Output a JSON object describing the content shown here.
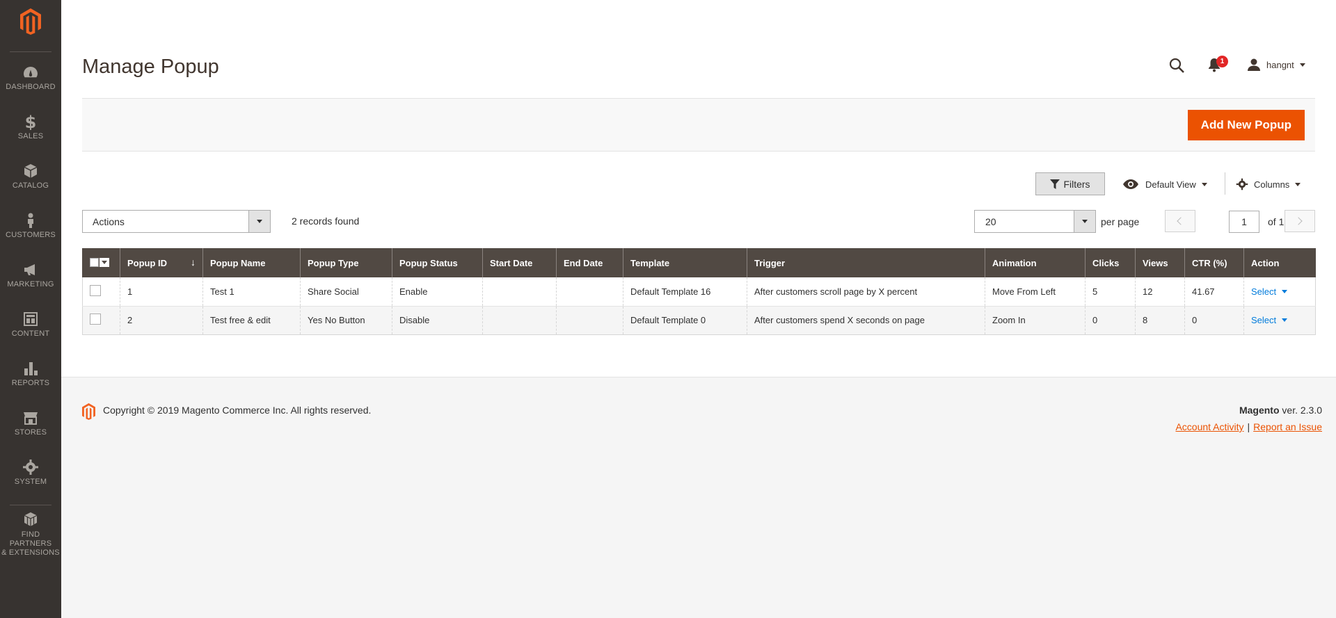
{
  "sidebar": {
    "items": [
      {
        "label": "DASHBOARD",
        "icon": "dashboard-icon"
      },
      {
        "label": "SALES",
        "icon": "dollar-icon"
      },
      {
        "label": "CATALOG",
        "icon": "box-icon"
      },
      {
        "label": "CUSTOMERS",
        "icon": "person-icon"
      },
      {
        "label": "MARKETING",
        "icon": "megaphone-icon"
      },
      {
        "label": "CONTENT",
        "icon": "layout-icon"
      },
      {
        "label": "REPORTS",
        "icon": "bar-chart-icon"
      },
      {
        "label": "STORES",
        "icon": "store-icon"
      },
      {
        "label": "SYSTEM",
        "icon": "gear-icon"
      },
      {
        "label_line1": "FIND PARTNERS",
        "label_line2": "& EXTENSIONS",
        "icon": "cubes-icon"
      }
    ]
  },
  "header": {
    "title": "Manage Popup",
    "notification_count": "1",
    "user_name": "hangnt"
  },
  "action_bar": {
    "add_label": "Add New Popup"
  },
  "toolbar": {
    "filters_label": "Filters",
    "view_label": "Default View",
    "columns_label": "Columns",
    "actions_label": "Actions",
    "records_found": "2 records found",
    "per_page_value": "20",
    "per_page_label": "per page",
    "current_page": "1",
    "of_pages": "of 1"
  },
  "grid": {
    "columns": [
      "Popup ID",
      "Popup Name",
      "Popup Type",
      "Popup Status",
      "Start Date",
      "End Date",
      "Template",
      "Trigger",
      "Animation",
      "Clicks",
      "Views",
      "CTR (%)",
      "Action"
    ],
    "sort_indicator": "↓",
    "rows": [
      {
        "id": "1",
        "name": "Test 1",
        "type": "Share Social",
        "status": "Enable",
        "start": "",
        "end": "",
        "template": "Default Template 16",
        "trigger": "After customers scroll page by X percent",
        "animation": "Move From Left",
        "clicks": "5",
        "views": "12",
        "ctr": "41.67",
        "action": "Select"
      },
      {
        "id": "2",
        "name": "Test free & edit",
        "type": "Yes No Button",
        "status": "Disable",
        "start": "",
        "end": "",
        "template": "Default Template 0",
        "trigger": "After customers spend X seconds on page",
        "animation": "Zoom In",
        "clicks": "0",
        "views": "8",
        "ctr": "0",
        "action": "Select"
      }
    ]
  },
  "footer": {
    "copyright": "Copyright © 2019 Magento Commerce Inc. All rights reserved.",
    "brand": "Magento",
    "version": " ver. 2.3.0",
    "link_activity": "Account Activity",
    "link_separator": "|",
    "link_issue": "Report an Issue"
  },
  "colors": {
    "accent": "#eb5202",
    "sidebar_bg": "#373330",
    "grid_header_bg": "#514943",
    "link": "#007bdb"
  }
}
